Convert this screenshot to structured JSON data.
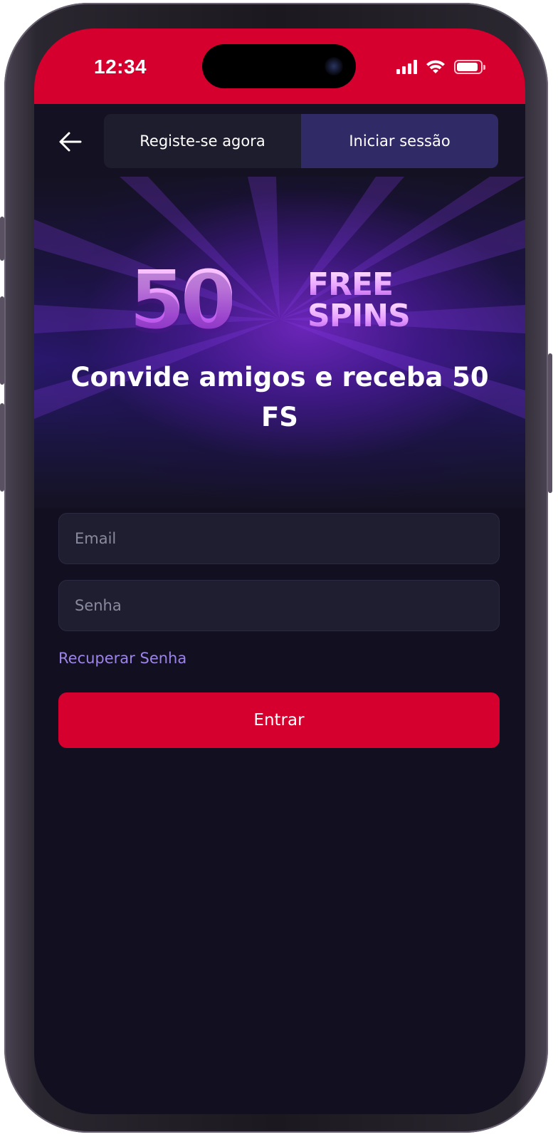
{
  "status_bar": {
    "time": "12:34",
    "signal_icon": "cellular-signal-icon",
    "wifi_icon": "wifi-icon",
    "battery_icon": "battery-icon",
    "battery_level": 0.9,
    "background_color": "#d6002f"
  },
  "header": {
    "back_icon": "arrow-left-icon",
    "tabs": [
      {
        "label": "Registe-se agora",
        "active": false
      },
      {
        "label": "Iniciar sessão",
        "active": true
      }
    ]
  },
  "banner": {
    "promo_number": "50",
    "promo_word_1": "FREE",
    "promo_word_2": "SPINS",
    "title": "Convide amigos e receba 50 FS"
  },
  "form": {
    "email_placeholder": "Email",
    "email_value": "",
    "password_placeholder": "Senha",
    "password_value": "",
    "recover_label": "Recuperar Senha",
    "submit_label": "Entrar"
  },
  "colors": {
    "accent": "#d6002f",
    "background": "#121020",
    "active_tab": "#302a66",
    "link": "#9d84e8"
  }
}
